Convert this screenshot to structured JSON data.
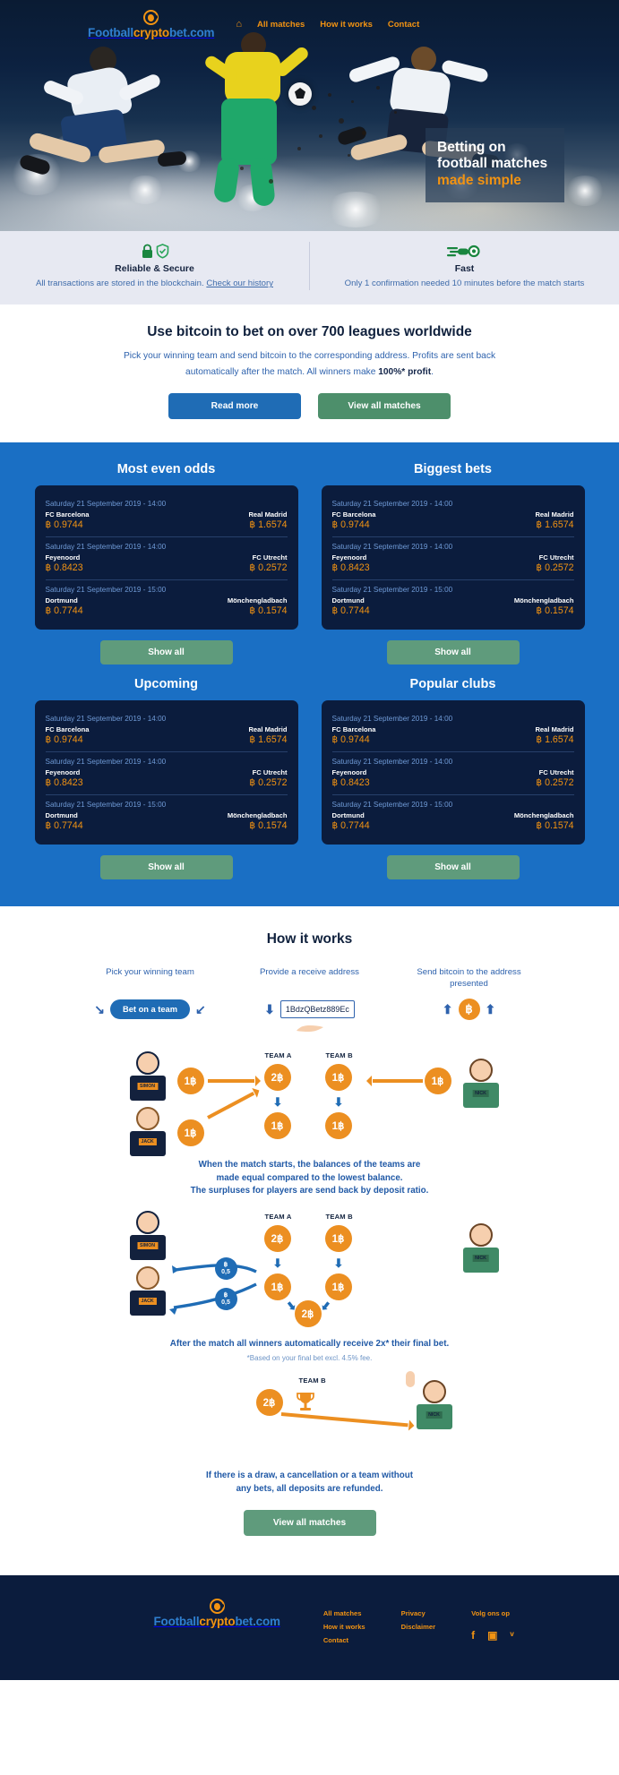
{
  "brand": {
    "part1": "Football",
    "part2": "crypto",
    "part3": "bet.com",
    "logo_icon": "soccer-ball-icon"
  },
  "nav": {
    "home_icon": "home-icon",
    "items": [
      {
        "label": "All matches"
      },
      {
        "label": "How it works"
      },
      {
        "label": "Contact"
      }
    ]
  },
  "hero": {
    "line1": "Betting on",
    "line2": "football matches",
    "line3": "made simple"
  },
  "features": [
    {
      "icons": [
        "lock-icon",
        "shield-icon"
      ],
      "title": "Reliable & Secure",
      "desc_pre": "All transactions are stored in the blockchain. ",
      "desc_link": "Check our history"
    },
    {
      "icons": [
        "fast-ball-icon"
      ],
      "title": "Fast",
      "desc_pre": "Only 1 confirmation needed 10 minutes before the match starts",
      "desc_link": ""
    }
  ],
  "intro": {
    "heading": "Use bitcoin to bet on over 700 leagues worldwide",
    "para_1": "Pick your winning team and send bitcoin to the corresponding address. Profits are sent back automatically after the match. All winners make ",
    "para_bold": "100%* profit",
    "para_2": ".",
    "btn_read_more": "Read more",
    "btn_view_matches": "View all matches"
  },
  "matches": {
    "show_all_label": "Show all",
    "sections": [
      {
        "title": "Most even odds"
      },
      {
        "title": "Biggest bets"
      },
      {
        "title": "Upcoming"
      },
      {
        "title": "Popular clubs"
      }
    ],
    "rows": [
      {
        "date": "Saturday 21 September 2019 - 14:00",
        "home_team": "FC Barcelona",
        "away_team": "Real Madrid",
        "home_odds": "฿ 0.9744",
        "away_odds": "฿ 1.6574"
      },
      {
        "date": "Saturday 21 September 2019 - 14:00",
        "home_team": "Feyenoord",
        "away_team": "FC Utrecht",
        "home_odds": "฿ 0.8423",
        "away_odds": "฿ 0.2572"
      },
      {
        "date": "Saturday 21 September 2019 - 15:00",
        "home_team": "Dortmund",
        "away_team": "Mönchengladbach",
        "home_odds": "฿ 0.7744",
        "away_odds": "฿ 0.1574"
      }
    ]
  },
  "how_it_works": {
    "heading": "How it works",
    "steps": [
      {
        "title": "Pick your winning team",
        "button_label": "Bet on a team",
        "icon": "arrow-in-icon"
      },
      {
        "title": "Provide a receive address",
        "address_value": "1BdzQBetz889Ec",
        "icon": "download-hand-icon"
      },
      {
        "title": "Send bitcoin to the address presented",
        "icon": "bitcoin-coin-icon"
      }
    ],
    "diagram1": {
      "team_a_label": "TEAM A",
      "team_b_label": "TEAM B",
      "person_left_top": "SIMON",
      "person_left_bottom": "JACK",
      "person_right": "NICK",
      "simon_bet": "1฿",
      "jack_bet": "1฿",
      "nick_bet": "1฿",
      "team_a_total": "2฿",
      "team_b_total": "1฿",
      "team_a_final": "1฿",
      "team_b_final": "1฿"
    },
    "note1_line1": "When the match starts, the balances of the teams are",
    "note1_line2": "made equal compared to the lowest balance.",
    "note1_line3": "The surpluses for players are send back by deposit ratio.",
    "diagram2": {
      "team_a_label": "TEAM A",
      "team_b_label": "TEAM B",
      "person_left_top": "SIMON",
      "person_left_bottom": "JACK",
      "person_right": "NICK",
      "team_a_start": "2฿",
      "team_b_start": "1฿",
      "team_a_mid": "1฿",
      "team_b_mid": "1฿",
      "pot_total": "2฿",
      "refund_top_currency": "฿",
      "refund_top_amount": "0,5",
      "refund_bottom_currency": "฿",
      "refund_bottom_amount": "0,5"
    },
    "note2": "After the match all winners automatically receive 2x* their final bet.",
    "note2_sub": "*Based on your final bet excl. 4.5% fee.",
    "diagram3": {
      "team_b_label": "TEAM B",
      "payout": "2฿",
      "winner_name": "NICK",
      "trophy_icon": "trophy-icon"
    },
    "note3_line1": "If there is a draw, a cancellation or a team without",
    "note3_line2": "any bets, all deposits are refunded.",
    "final_button": "View all matches"
  },
  "footer": {
    "brand": {
      "part1": "Football",
      "part2": "crypto",
      "part3": "bet.com"
    },
    "col1": [
      {
        "label": "All matches"
      },
      {
        "label": "How it works"
      },
      {
        "label": "Contact"
      }
    ],
    "col2": [
      {
        "label": "Privacy"
      },
      {
        "label": "Disclaimer"
      }
    ],
    "social_title": "Volg ons op",
    "socials": [
      {
        "name": "facebook-icon",
        "glyph": "f"
      },
      {
        "name": "instagram-icon",
        "glyph": "▣"
      },
      {
        "name": "twitter-icon",
        "glyph": "ᵛ"
      }
    ]
  },
  "colors": {
    "brand_blue": "#2f7fd0",
    "brand_orange": "#f29312",
    "dark_navy": "#0b1c3d",
    "section_blue": "#1a6fc4",
    "green_button": "#5f9b7c",
    "blue_button": "#1f6cb5"
  }
}
